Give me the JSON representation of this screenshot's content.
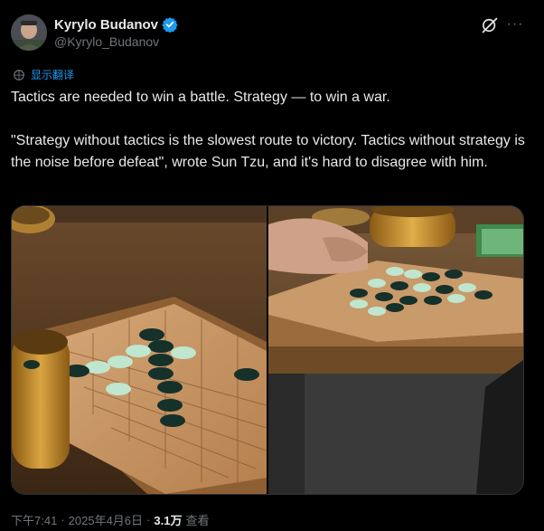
{
  "author": {
    "display_name": "Kyrylo Budanov",
    "handle": "@Kyrylo_Budanov",
    "verified_icon": "verified-badge-icon",
    "avatar_icon": "avatar"
  },
  "header_actions": {
    "grok_icon": "grok-icon",
    "more_icon": "more-icon",
    "more_label": "···"
  },
  "translate": {
    "label": "显示翻译",
    "icon": "translate-icon"
  },
  "tweet": {
    "paragraphs": [
      "Tactics are needed to win a battle. Strategy — to win a war.",
      "\"Strategy without tactics is the slowest route to victory. Tactics without strategy is the noise before defeat\", wrote Sun Tzu, and it's hard to disagree with him."
    ]
  },
  "media": {
    "photos": [
      "go-board-photo-left",
      "go-board-photo-right"
    ]
  },
  "meta": {
    "time": "下午7:41",
    "date": "2025年4月6日",
    "separator": "·",
    "views_count": "3.1万",
    "views_label": "查看"
  },
  "colors": {
    "background": "#000000",
    "text": "#e7e9ea",
    "secondary": "#71767b",
    "accent": "#1d9bf0"
  }
}
